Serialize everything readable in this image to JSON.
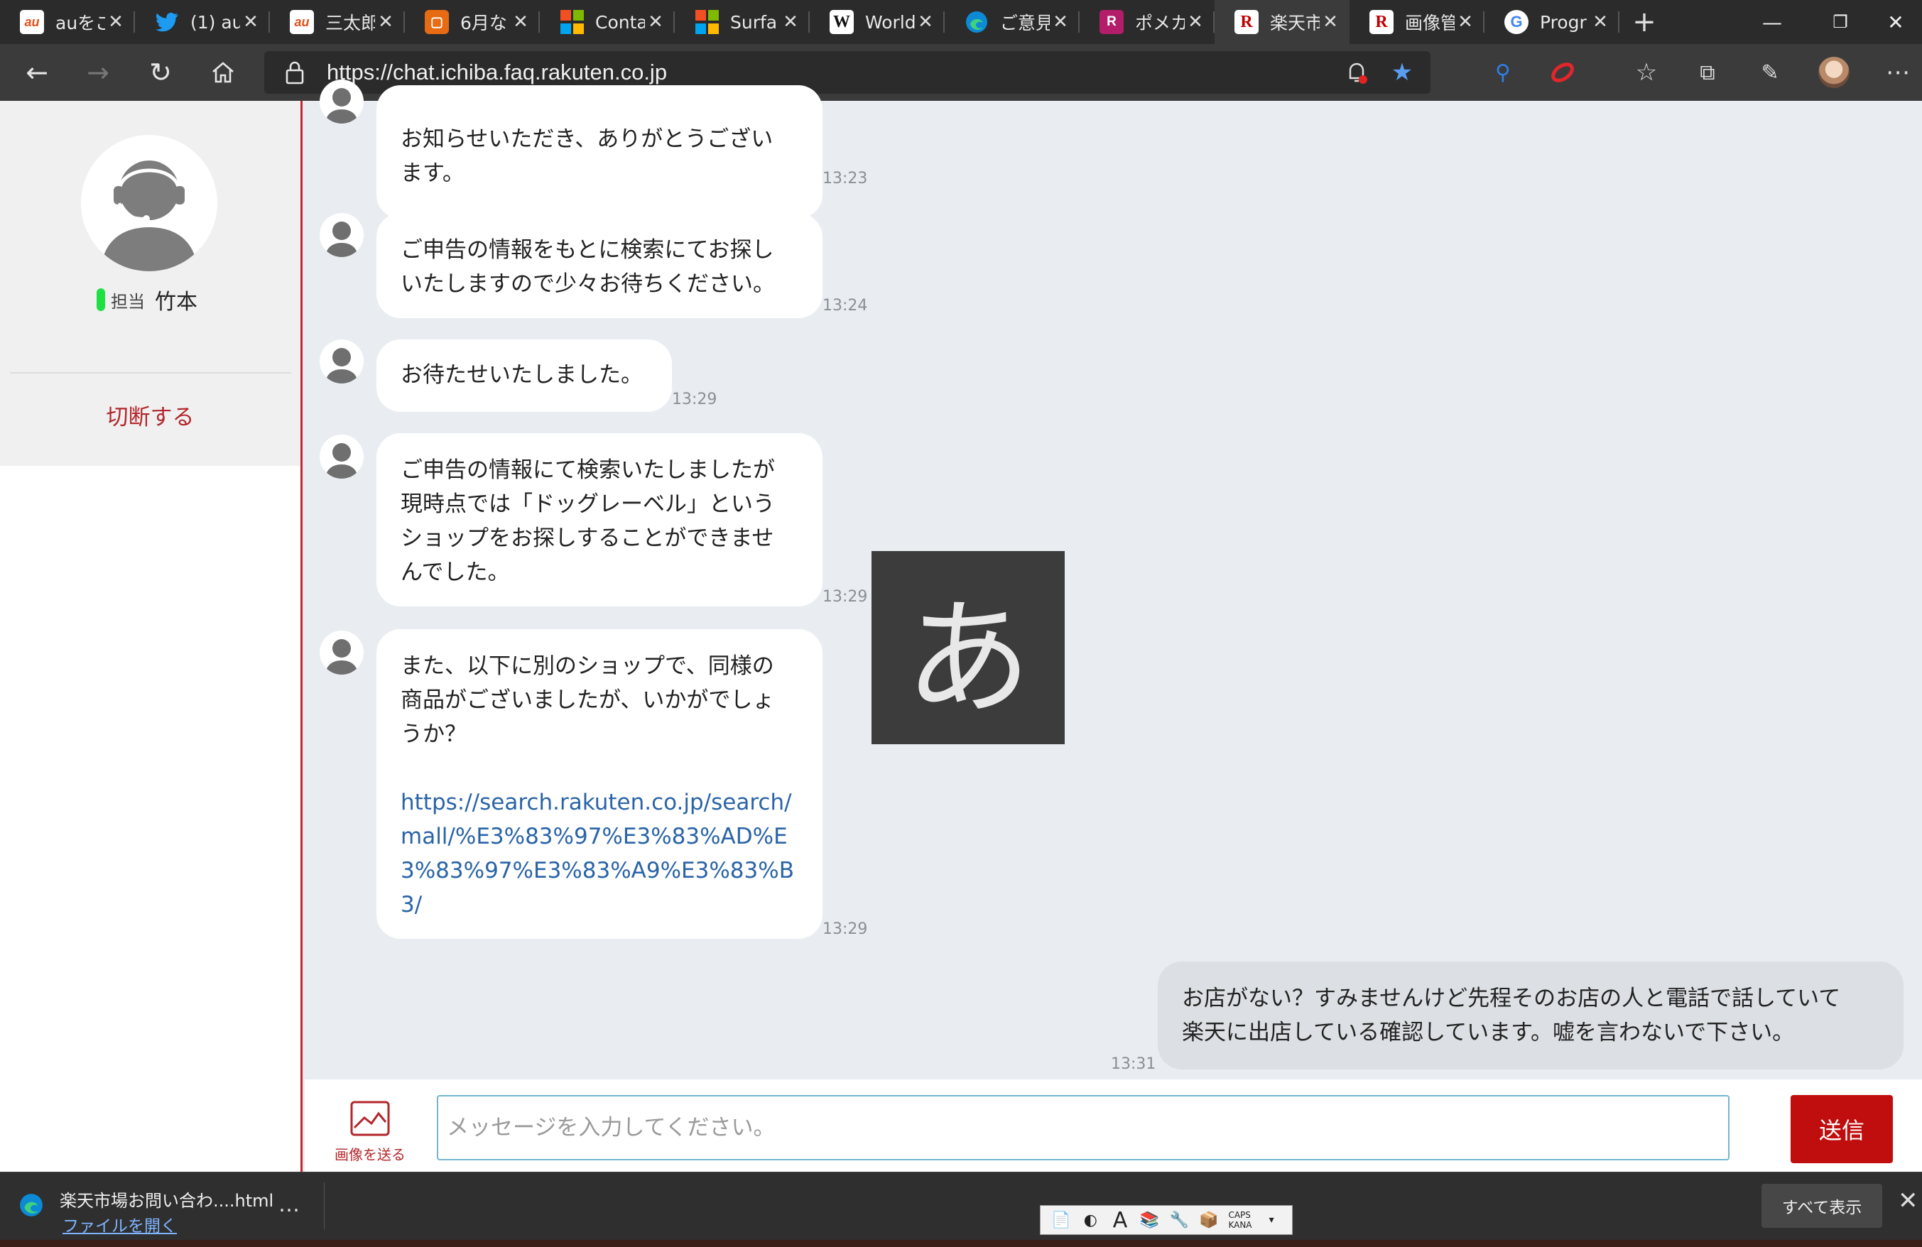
{
  "tabs": [
    {
      "title": "auをご",
      "icon": "au-favicon"
    },
    {
      "title": "(1) au",
      "icon": "twitter-favicon"
    },
    {
      "title": "三太郎",
      "icon": "au-favicon"
    },
    {
      "title": "6月な",
      "icon": "orange-favicon"
    },
    {
      "title": "Conta",
      "icon": "microsoft-favicon"
    },
    {
      "title": "Surfa",
      "icon": "microsoft-favicon"
    },
    {
      "title": "World",
      "icon": "wikipedia-favicon"
    },
    {
      "title": "ご意見",
      "icon": "edge-favicon"
    },
    {
      "title": "ポメカ",
      "icon": "rakuten-pink-favicon"
    },
    {
      "title": "楽天市",
      "icon": "rakuten-favicon",
      "active": true
    },
    {
      "title": "画像管",
      "icon": "rakuten-favicon"
    },
    {
      "title": "Progr",
      "icon": "google-favicon"
    }
  ],
  "url": "https://chat.ichiba.faq.rakuten.co.jp",
  "sidebar": {
    "tanto_label": "担当",
    "agent_name": "竹本",
    "disconnect_label": "切断する"
  },
  "messages": [
    {
      "from": "agent",
      "text": "お知らせいただき、ありがとうござい\nます。",
      "time": "13:23"
    },
    {
      "from": "agent",
      "text": "ご申告の情報をもとに検索にてお探し\nいたしますので少々お待ちください。",
      "time": "13:24"
    },
    {
      "from": "agent",
      "text": "お待たせいたしました。",
      "time": "13:29"
    },
    {
      "from": "agent",
      "text": "ご申告の情報にて検索いたしましたが\n現時点では「ドッグレーベル」という\nショップをお探しすることができませ\nんでした。",
      "time": "13:29"
    },
    {
      "from": "agent",
      "text": "また、以下に別のショップで、同様の\n商品がございましたが、いかがでしょ\nうか？",
      "link": "https://search.rakuten.co.jp/search/mall/%E3%83%97%E3%83%AD%E3%83%97%E3%83%A9%E3%83%B3/",
      "time": "13:29"
    },
    {
      "from": "user",
      "text": "お店がない？すみませんけど先程そのお店の人と電話で話していて\n楽天に出店している確認しています。嘘を言わないで下さい。",
      "time": "13:31"
    }
  ],
  "ime_indicator": "あ",
  "composer": {
    "attach_label": "画像を送る",
    "placeholder": "メッセージを入力してください。",
    "value": "",
    "send_label": "送信"
  },
  "download": {
    "filename": "楽天市場お問い合わ....html",
    "open_label": "ファイルを開く",
    "more": "…",
    "show_all": "すべて表示",
    "close": "✕"
  },
  "ime_toolbar": {
    "caps": "CAPS",
    "kana": "KANA"
  },
  "colors": {
    "accent_red": "#c00d0d",
    "online": "#1ee042",
    "link": "#2a64a7"
  }
}
